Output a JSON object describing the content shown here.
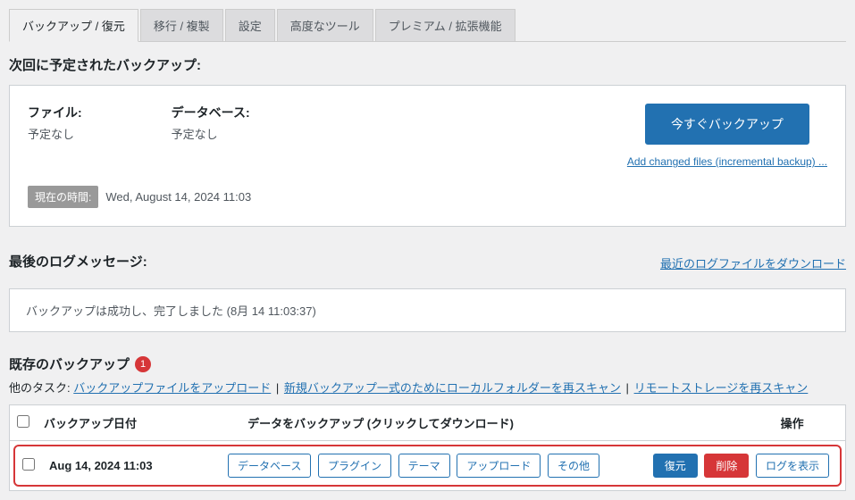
{
  "tabs": {
    "backup_restore": "バックアップ / 復元",
    "migrate": "移行 / 複製",
    "settings": "設定",
    "advanced": "高度なツール",
    "premium": "プレミアム / 拡張機能"
  },
  "next_scheduled": {
    "title": "次回に予定されたバックアップ:",
    "files_label": "ファイル:",
    "files_value": "予定なし",
    "db_label": "データベース:",
    "db_value": "予定なし",
    "time_label": "現在の時間:",
    "time_value": "Wed, August 14, 2024 11:03",
    "backup_now_button": "今すぐバックアップ",
    "incremental_link": "Add changed files (incremental backup) ..."
  },
  "log": {
    "title": "最後のログメッセージ:",
    "download_link": "最近のログファイルをダウンロード",
    "message": "バックアップは成功し、完了しました (8月 14 11:03:37)"
  },
  "existing": {
    "title": "既存のバックアップ",
    "count": "1",
    "tasks_label": "他のタスク:",
    "upload_link": "バックアップファイルをアップロード",
    "rescan_local_link": "新規バックアップ一式のためにローカルフォルダーを再スキャン",
    "rescan_remote_link": "リモートストレージを再スキャン",
    "table": {
      "col_date": "バックアップ日付",
      "col_data": "データをバックアップ (クリックしてダウンロード)",
      "col_actions": "操作"
    },
    "rows": [
      {
        "date": "Aug 14, 2024 11:03",
        "entities": {
          "database": "データベース",
          "plugins": "プラグイン",
          "themes": "テーマ",
          "uploads": "アップロード",
          "others": "その他"
        },
        "actions": {
          "restore": "復元",
          "delete": "削除",
          "viewlog": "ログを表示"
        }
      }
    ]
  }
}
